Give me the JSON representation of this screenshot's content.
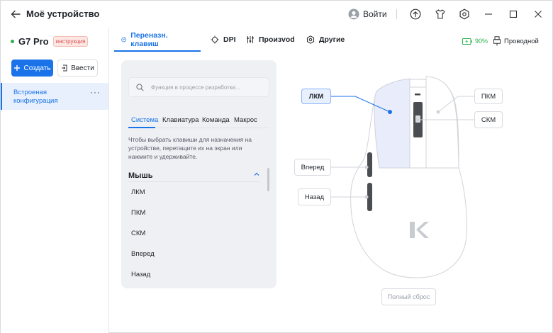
{
  "window": {
    "title": "Моё устройство",
    "login_label": "Войти"
  },
  "sidebar": {
    "device_name": "G7 Pro",
    "device_badge": "инструкция",
    "create_label": "Создать",
    "import_label": "Ввести",
    "configs": [
      {
        "label": "Встроеная конфигурация",
        "more": "···"
      }
    ]
  },
  "tabs": [
    {
      "label": "Переназн. клавиш",
      "icon": "remap-icon",
      "active": true
    },
    {
      "label": "DPI",
      "icon": "crosshair-icon",
      "active": false
    },
    {
      "label": "Произvod",
      "icon": "sliders-icon",
      "active": false
    },
    {
      "label": "Другие",
      "icon": "settings-icon",
      "active": false
    }
  ],
  "status": {
    "battery": "90%",
    "connection": "Проводной"
  },
  "panel": {
    "search_placeholder": "Функция в процессе разработки...",
    "subtabs": [
      "Система",
      "Клавиатура",
      "Команда",
      "Макрос"
    ],
    "hint": "Чтобы выбрать клавиши для назначения на устройстве, перетащите их на экран или нажмите и удерживайте.",
    "section_title": "Мышь",
    "items": [
      "ЛКМ",
      "ПКМ",
      "СКМ",
      "Вперед",
      "Назад"
    ]
  },
  "diagram": {
    "callouts": {
      "lkm": "ЛКМ",
      "pkm": "ПКМ",
      "skm": "СКМ",
      "forward": "Вперед",
      "back": "Назад"
    },
    "reset_label": "Полный сброс"
  },
  "colors": {
    "accent": "#1a73e8",
    "battery": "#2bb24c",
    "badge": "#d9534f"
  }
}
